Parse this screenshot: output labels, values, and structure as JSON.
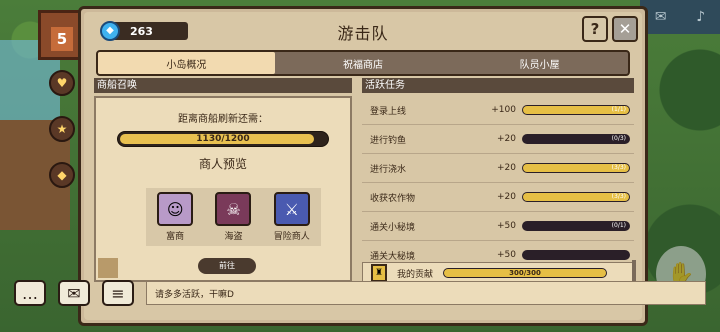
{
  "header": {
    "title": "游击队",
    "gem_value": "263",
    "help_label": "?",
    "close_label": "✕"
  },
  "tabs": [
    {
      "label": "小岛概况",
      "active": true
    },
    {
      "label": "祝福商店",
      "active": false
    },
    {
      "label": "队员小屋",
      "active": false
    }
  ],
  "ship": {
    "section_title": "商船召唤",
    "refresh_label": "距离商船刷新还需：",
    "progress_text": "1130/1200",
    "progress": 0.9417,
    "preview_title": "商人预览",
    "merchants": [
      {
        "name": "富商",
        "icon": "rich-merchant-icon"
      },
      {
        "name": "海盗",
        "icon": "pirate-icon"
      },
      {
        "name": "冒险商人",
        "icon": "adventure-merchant-icon"
      }
    ],
    "go_label": "前往"
  },
  "tasks": {
    "section_title": "活跃任务",
    "items": [
      {
        "name": "登录上线",
        "points": "+100",
        "progress_text": "(1/1)",
        "progress": 1.0
      },
      {
        "name": "进行钓鱼",
        "points": "+20",
        "progress_text": "(0/3)",
        "progress": 0.0
      },
      {
        "name": "进行浇水",
        "points": "+20",
        "progress_text": "(3/3)",
        "progress": 1.0
      },
      {
        "name": "收获农作物",
        "points": "+20",
        "progress_text": "(3/3)",
        "progress": 1.0
      },
      {
        "name": "通关小秘境",
        "points": "+50",
        "progress_text": "(0/1)",
        "progress": 0.0
      },
      {
        "name": "通关大秘境",
        "points": "+50",
        "progress_text": "",
        "progress": 0.0
      }
    ],
    "contribution_label": "我的贡献",
    "contribution_text": "300/300",
    "contribution_progress": 1.0
  },
  "footer": {
    "message": "请多多活跃，干嘛D"
  },
  "hud": {
    "hut_number": "5"
  }
}
